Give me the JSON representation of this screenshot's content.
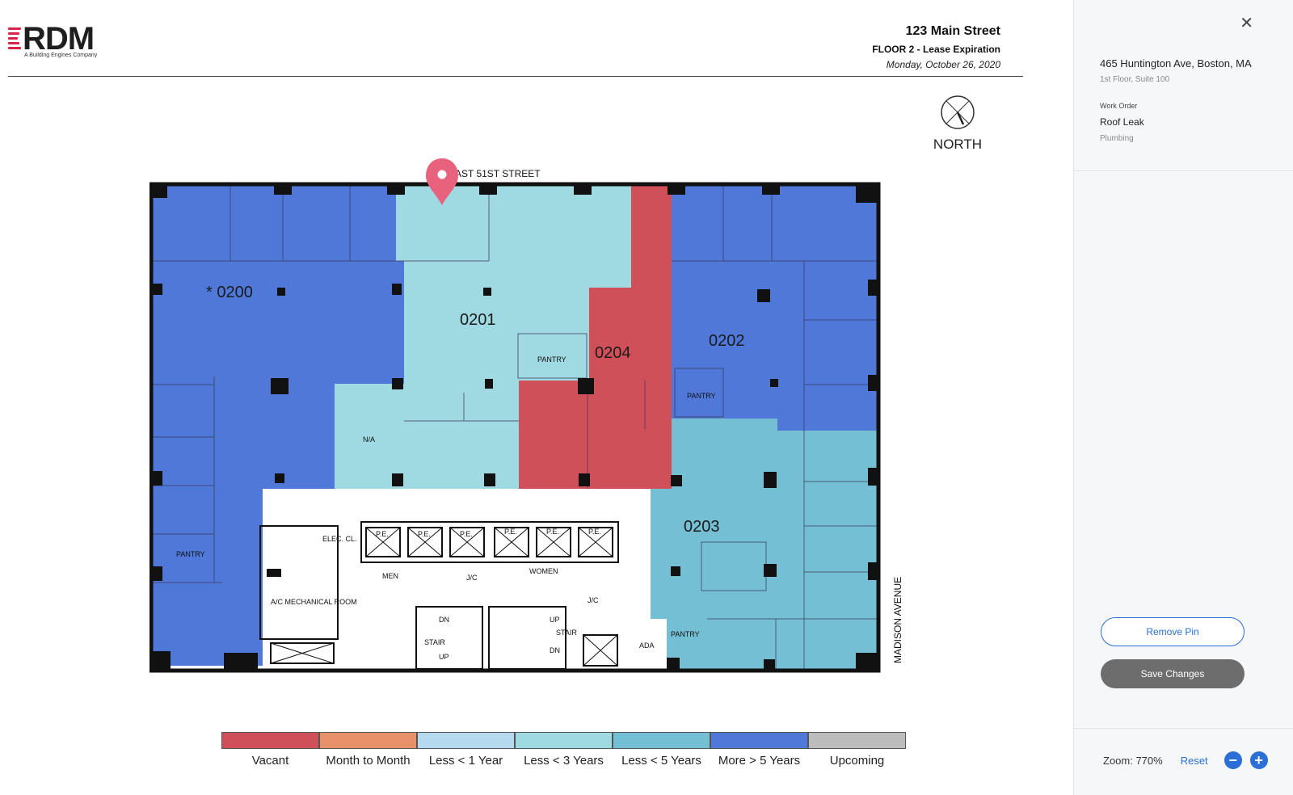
{
  "document": {
    "logo_text": "RDM",
    "logo_tagline": "A Building Engines Company",
    "address": "123 Main Street",
    "floor_title": "FLOOR 2 - Lease Expiration",
    "date": "Monday, October 26, 2020",
    "compass_label": "NORTH"
  },
  "floor_plan": {
    "street_north": "EAST 51ST STREET",
    "street_east": "MADISON AVENUE",
    "rooms": [
      {
        "id": "0200",
        "label": "* 0200",
        "status": "More > 5 Years"
      },
      {
        "id": "0201",
        "label": "0201",
        "status": "Less < 3 Years"
      },
      {
        "id": "0204",
        "label": "0204",
        "status": "Vacant"
      },
      {
        "id": "0202",
        "label": "0202",
        "status": "More > 5 Years"
      },
      {
        "id": "0203",
        "label": "0203",
        "status": "Less < 5 Years"
      },
      {
        "id": "na",
        "label": "N/A",
        "status": "Less < 3 Years"
      }
    ],
    "annotations": {
      "pantry": "PANTRY",
      "elec": "ELEC. CL.",
      "ac": "A/C MECHANICAL ROOM",
      "men": "MEN",
      "women": "WOMEN",
      "stair": "STAIR",
      "ada": "ADA",
      "pe": "P.E.",
      "jc": "J/C",
      "up": "UP",
      "dn": "DN"
    }
  },
  "legend": [
    {
      "label": "Vacant",
      "color": "#d0505a"
    },
    {
      "label": "Month to Month",
      "color": "#e8906a"
    },
    {
      "label": "Less < 1 Year",
      "color": "#b5d9ef"
    },
    {
      "label": "Less < 3 Years",
      "color": "#9fd9e1"
    },
    {
      "label": "Less < 5 Years",
      "color": "#74bfd3"
    },
    {
      "label": "More > 5 Years",
      "color": "#4f78d8"
    },
    {
      "label": "Upcoming",
      "color": "#bcbcbc"
    }
  ],
  "panel": {
    "close_icon": "close-icon",
    "address": "465 Huntington Ave, Boston, MA",
    "unit": "1st Floor, Suite 100",
    "work_order_label": "Work Order",
    "work_order_title": "Roof Leak",
    "work_order_category": "Plumbing",
    "remove_pin": "Remove Pin",
    "save_changes": "Save Changes",
    "zoom_label": "Zoom: 770%",
    "reset": "Reset",
    "zoom_out": "−",
    "zoom_in": "+"
  }
}
